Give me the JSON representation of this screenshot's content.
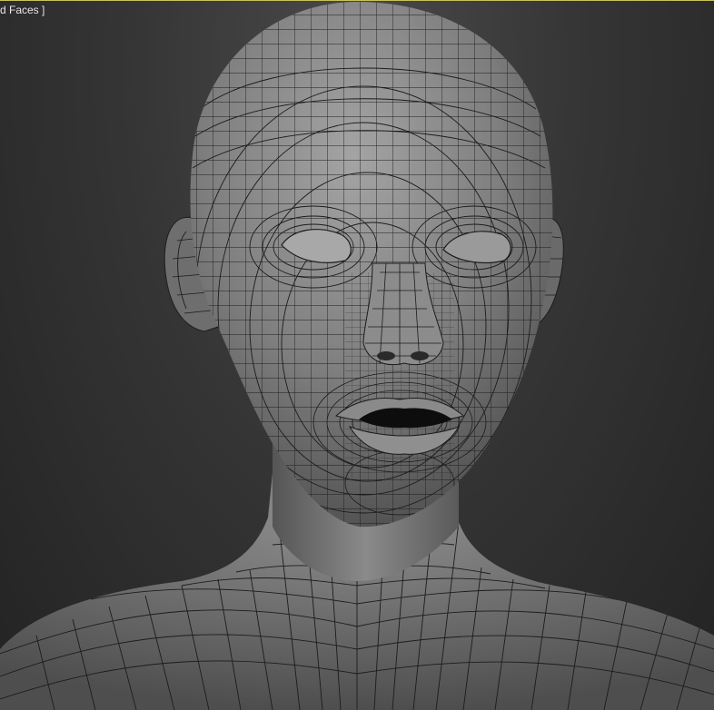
{
  "viewport": {
    "label": "d Faces ]",
    "label_color": "#e6e6e6",
    "active_border_color": "#c9c35a",
    "background_color": "#2f2f2f",
    "shading_mode": "edged-faces",
    "subject": "head-bust-mesh",
    "mesh_color": "#8a8a8a",
    "wire_color": "#1a1a1a"
  }
}
